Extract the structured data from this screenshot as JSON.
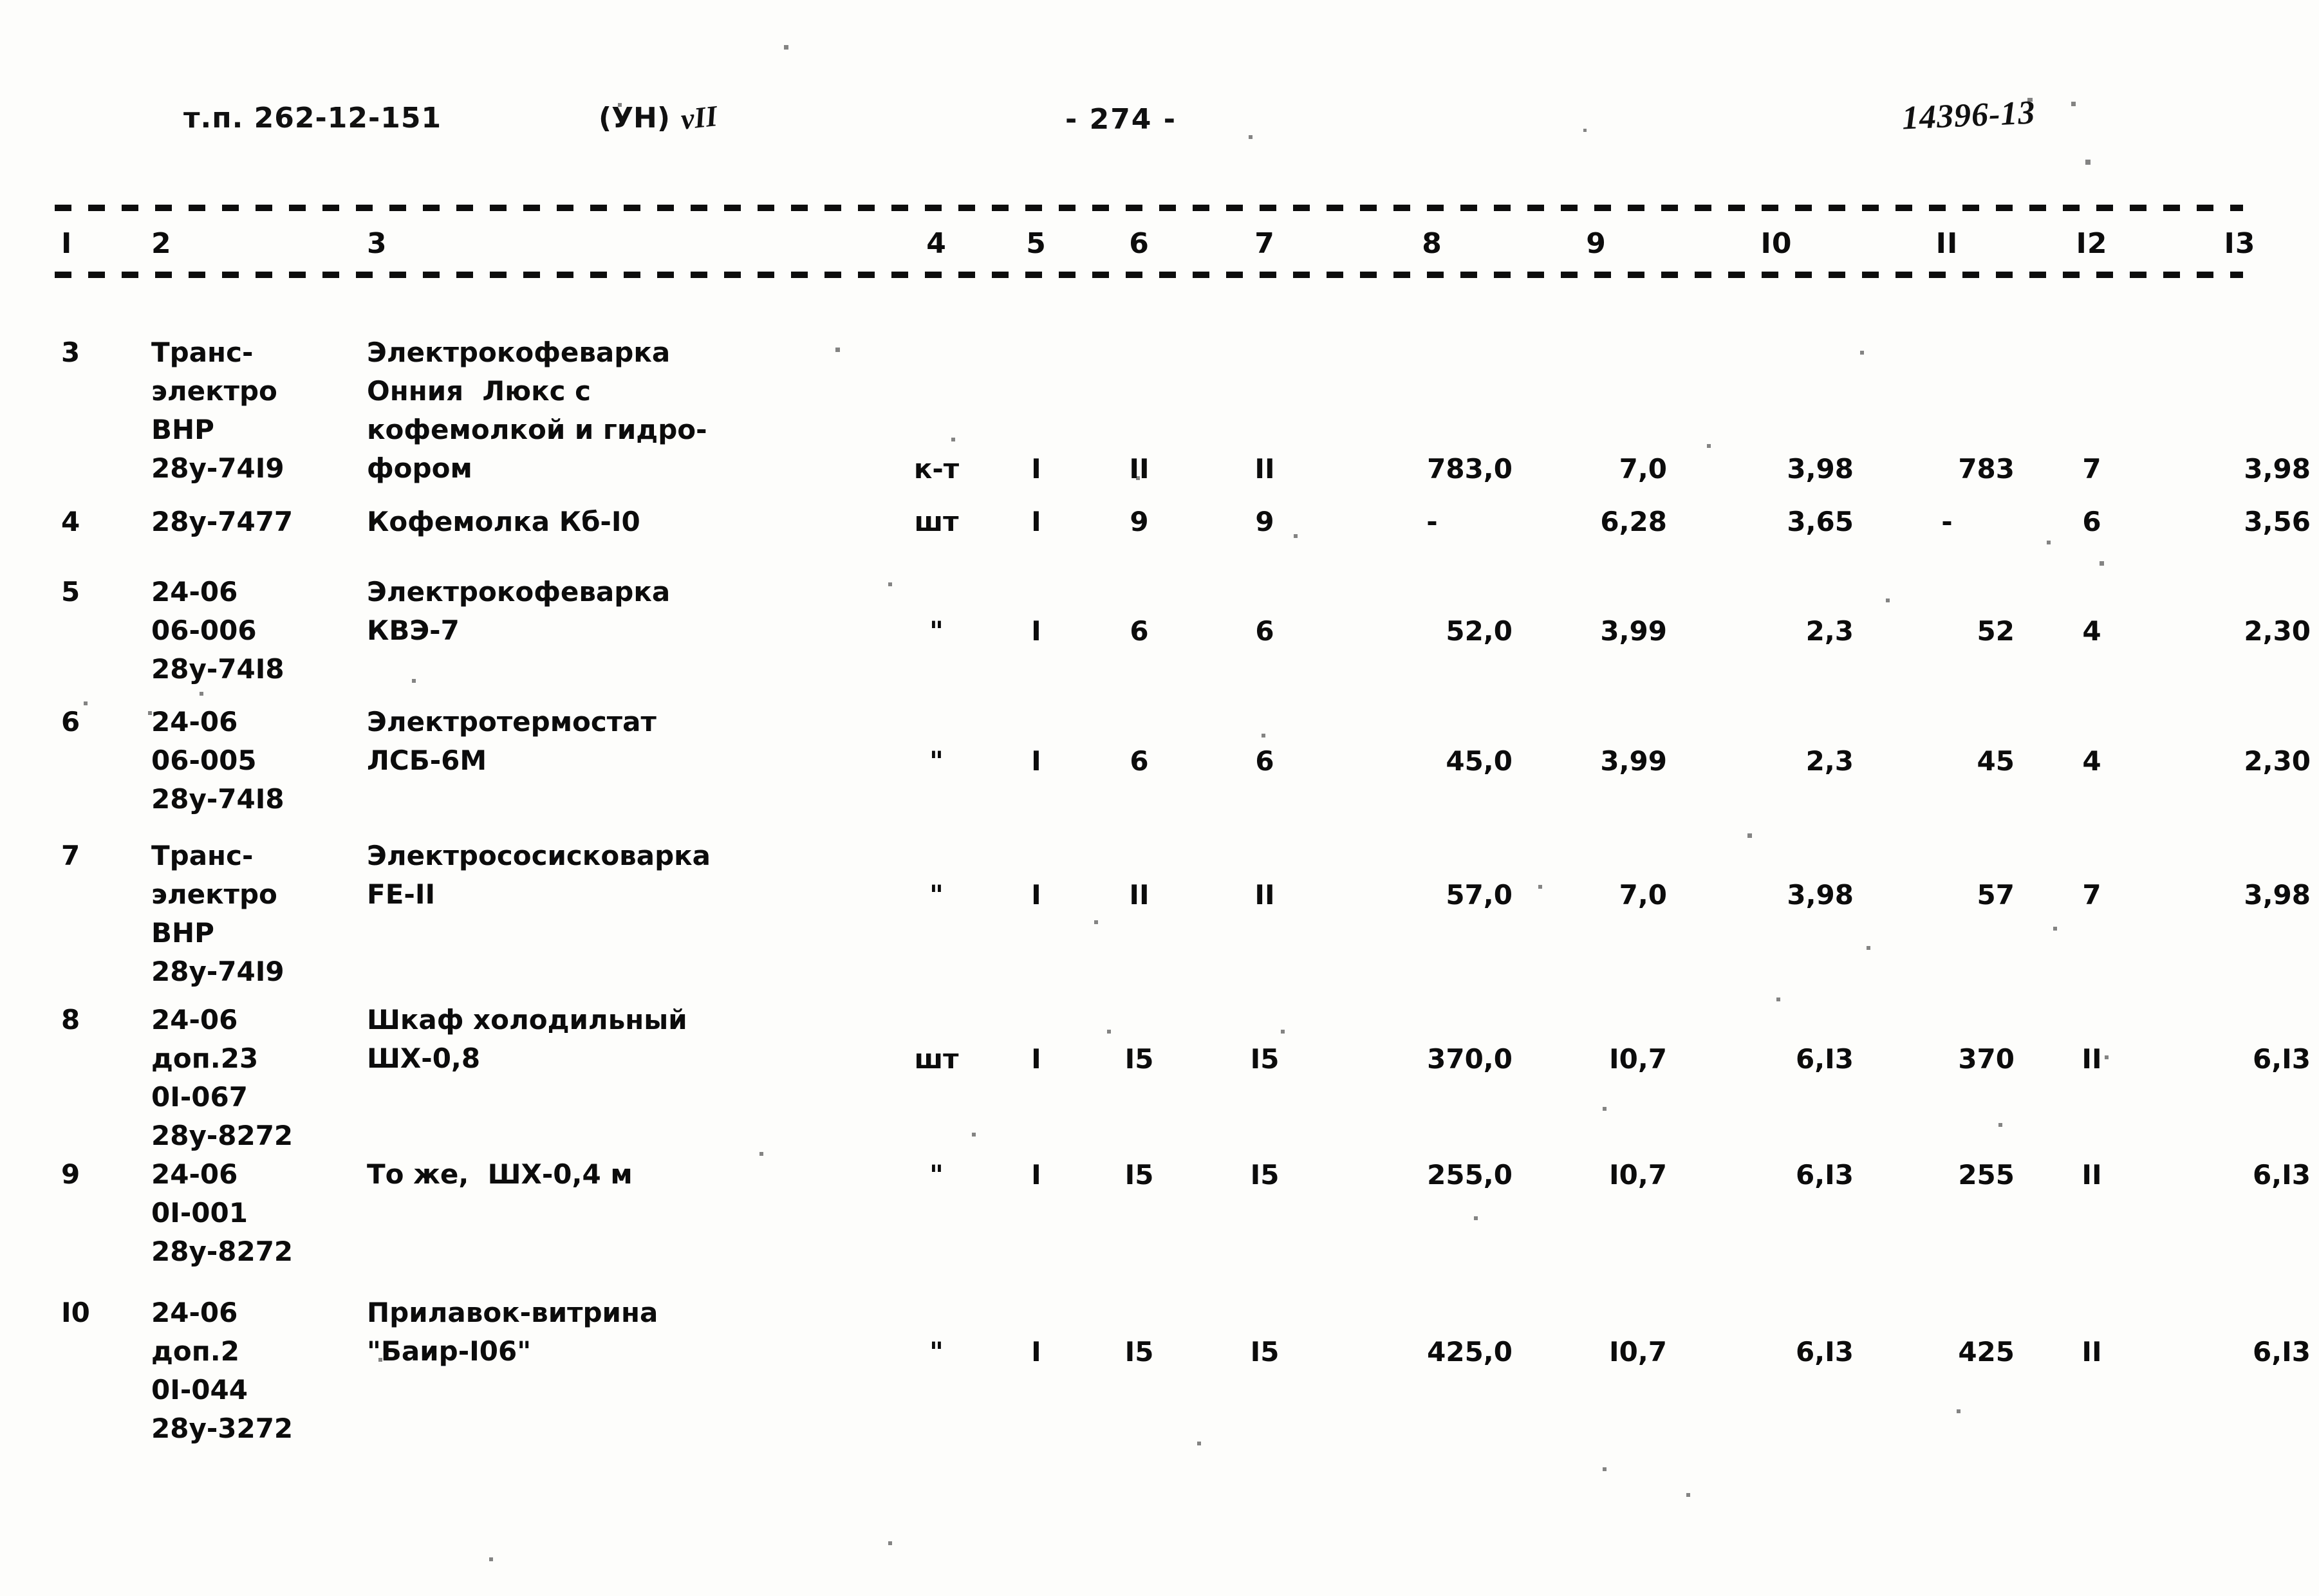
{
  "header": {
    "doc_code": "т.п. 262-12-151",
    "series_mark": "(УН)",
    "hand_annotation": "vII",
    "page_number": "- 274 -",
    "archive_stamp": "14396-13"
  },
  "table": {
    "column_headers": [
      "I",
      "2",
      "3",
      "4",
      "5",
      "6",
      "7",
      "8",
      "9",
      "I0",
      "II",
      "I2",
      "I3"
    ],
    "rows": [
      {
        "c1": "3",
        "c2": "Транс-\nэлектро\nВНР\n28у-74I9",
        "c3": "Электрокофеварка\nОнния  Люкс с\nкофемолкой и гидро-\nфором",
        "c4": "к-т",
        "c5": "I",
        "c6": "II",
        "c7": "II",
        "c8": "783,0",
        "c9": "7,0",
        "c10": "3,98",
        "c11": "783",
        "c12": "7",
        "c13": "3,98"
      },
      {
        "c1": "4",
        "c2": "28у-7477",
        "c3": "Кофемолка Кб-I0",
        "c4": "шт",
        "c5": "I",
        "c6": "9",
        "c7": "9",
        "c8": "-",
        "c9": "6,28",
        "c10": "3,65",
        "c11": "-",
        "c12": "6",
        "c13": "3,56"
      },
      {
        "c1": "5",
        "c2": "24-06\n06-006\n28у-74I8",
        "c3": "Электрокофеварка\nКВЭ-7",
        "c4": "\"",
        "c5": "I",
        "c6": "6",
        "c7": "6",
        "c8": "52,0",
        "c9": "3,99",
        "c10": "2,3",
        "c11": "52",
        "c12": "4",
        "c13": "2,30"
      },
      {
        "c1": "6",
        "c2": "24-06\n06-005\n28у-74I8",
        "c3": "Электротермостат\nЛСБ-6М",
        "c4": "\"",
        "c5": "I",
        "c6": "6",
        "c7": "6",
        "c8": "45,0",
        "c9": "3,99",
        "c10": "2,3",
        "c11": "45",
        "c12": "4",
        "c13": "2,30"
      },
      {
        "c1": "7",
        "c2": "Транс-\nэлектро\nВНР\n28у-74I9",
        "c3": "Электрососисковарка\nFE-II",
        "c4": "\"",
        "c5": "I",
        "c6": "II",
        "c7": "II",
        "c8": "57,0",
        "c9": "7,0",
        "c10": "3,98",
        "c11": "57",
        "c12": "7",
        "c13": "3,98"
      },
      {
        "c1": "8",
        "c2": "24-06\nдоп.23\n0I-067\n28у-8272",
        "c3": "Шкаф холодильный\nШХ-0,8",
        "c4": "шт",
        "c5": "I",
        "c6": "I5",
        "c7": "I5",
        "c8": "370,0",
        "c9": "I0,7",
        "c10": "6,I3",
        "c11": "370",
        "c12": "II",
        "c13": "6,I3"
      },
      {
        "c1": "9",
        "c2": "24-06\n0I-001\n28у-8272",
        "c3": "То же,  ШХ-0,4 м",
        "c4": "\"",
        "c5": "I",
        "c6": "I5",
        "c7": "I5",
        "c8": "255,0",
        "c9": "I0,7",
        "c10": "6,I3",
        "c11": "255",
        "c12": "II",
        "c13": "6,I3"
      },
      {
        "c1": "I0",
        "c2": "24-06\nдоп.2\n0I-044\n28у-3272",
        "c3": "Прилавок-витрина\n\"Баир-I06\"",
        "c4": "\"",
        "c5": "I",
        "c6": "I5",
        "c7": "I5",
        "c8": "425,0",
        "c9": "I0,7",
        "c10": "6,I3",
        "c11": "425",
        "c12": "II",
        "c13": "6,I3"
      }
    ]
  }
}
